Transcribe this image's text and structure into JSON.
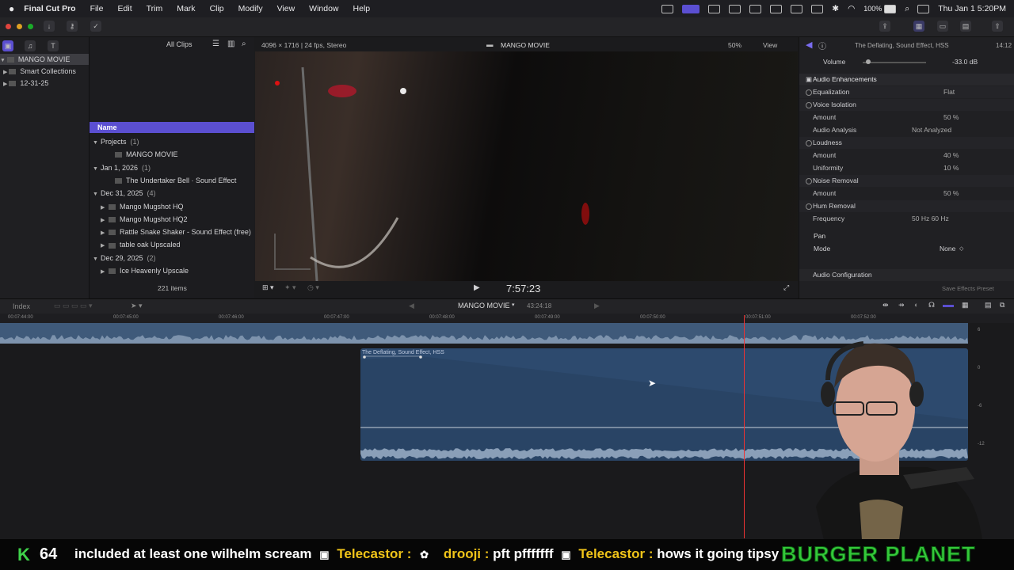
{
  "menubar": {
    "app_name": "Final Cut Pro",
    "menus": [
      "File",
      "Edit",
      "Trim",
      "Mark",
      "Clip",
      "Modify",
      "View",
      "Window",
      "Help"
    ],
    "battery": "100%",
    "clock": "Thu Jan 1  5:20PM"
  },
  "library": {
    "items": [
      {
        "label": "MANGO MOVIE",
        "selected": true
      },
      {
        "label": "Smart Collections",
        "selected": false
      },
      {
        "label": "12-31-25",
        "selected": false
      }
    ]
  },
  "browser": {
    "filter_label": "All Clips",
    "column_header": "Name",
    "rows": [
      {
        "indent": 0,
        "disclosure": "▼",
        "name": "Projects",
        "count": "(1)"
      },
      {
        "indent": 2,
        "disclosure": "",
        "name": "MANGO MOVIE",
        "count": ""
      },
      {
        "indent": 0,
        "disclosure": "▼",
        "name": "Jan 1, 2026",
        "count": "(1)"
      },
      {
        "indent": 2,
        "disclosure": "",
        "name": "The Undertaker Bell · Sound Effect",
        "count": ""
      },
      {
        "indent": 0,
        "disclosure": "▼",
        "name": "Dec 31, 2025",
        "count": "(4)"
      },
      {
        "indent": 1,
        "disclosure": "▶",
        "name": "Mango Mugshot HQ",
        "count": ""
      },
      {
        "indent": 1,
        "disclosure": "▶",
        "name": "Mango Mugshot HQ2",
        "count": ""
      },
      {
        "indent": 1,
        "disclosure": "▶",
        "name": "Rattle Snake Shaker - Sound Effect (free)",
        "count": ""
      },
      {
        "indent": 1,
        "disclosure": "▶",
        "name": "table oak Upscaled",
        "count": ""
      },
      {
        "indent": 0,
        "disclosure": "▼",
        "name": "Dec 29, 2025",
        "count": "(2)"
      },
      {
        "indent": 1,
        "disclosure": "▶",
        "name": "Ice Heavenly Upscale",
        "count": ""
      }
    ],
    "item_count": "221 items"
  },
  "viewer": {
    "format": "4096 × 1716 | 24 fps, Stereo",
    "title": "MANGO MOVIE",
    "zoom": "50%",
    "view_menu": "View",
    "timecode": "7:57:23"
  },
  "inspector": {
    "clip_title": "The Deflating, Sound Effect, HSS",
    "duration": "14:12",
    "volume_label": "Volume",
    "volume_value": "-33.0 dB",
    "section_title": "Audio Enhancements",
    "rows": [
      {
        "label": "Equalization",
        "value": "Flat",
        "check": true
      },
      {
        "label": "Voice Isolation",
        "value": "",
        "check": true
      },
      {
        "label": "Amount",
        "value": "50 %",
        "check": false
      },
      {
        "label": "Audio Analysis",
        "value": "Not Analyzed",
        "check": false
      },
      {
        "label": "Loudness",
        "value": "",
        "check": true
      },
      {
        "label": "Amount",
        "value": "40 %",
        "check": false
      },
      {
        "label": "Uniformity",
        "value": "10 %",
        "check": false
      },
      {
        "label": "Noise Removal",
        "value": "",
        "check": true
      },
      {
        "label": "Amount",
        "value": "50 %",
        "check": false
      },
      {
        "label": "Hum Removal",
        "value": "",
        "check": true
      },
      {
        "label": "Frequency",
        "value": "50 Hz    60 Hz",
        "check": false
      }
    ],
    "pan_title": "Pan",
    "mode_label": "Mode",
    "mode_value": "None",
    "audio_config": "Audio Configuration",
    "save_preset": "Save Effects Preset"
  },
  "timeline": {
    "index_label": "Index",
    "project_name": "MANGO MOVIE",
    "duration": "43:24:18",
    "ruler_ticks": [
      "00:07:44:00",
      "00:07:45:00",
      "00:07:46:00",
      "00:07:47:00",
      "00:07:48:00",
      "00:07:49:00",
      "00:07:50:00",
      "00:07:51:00",
      "00:07:52:00"
    ],
    "clip_name": "The Deflating, Sound Effect, HSS",
    "meter_labels": [
      "6",
      "0",
      "-6",
      "-12"
    ]
  },
  "overlay": {
    "counter_letter": "K",
    "counter_value": "64",
    "ticker_segments": [
      {
        "user": "",
        "text": "included at least one wilhelm scream"
      },
      {
        "user": "Telecastor :",
        "text": ""
      },
      {
        "user": "drooji :",
        "text": "pft pfffffff"
      },
      {
        "user": "Telecastor :",
        "text": "hows it going tipsy"
      }
    ],
    "brand": "BURGER PLANET"
  },
  "colors": {
    "accent_purple": "#5b4fd1",
    "clip_blue": "#2d4a6e",
    "waveform": "#7d93ad",
    "playhead": "#e33333",
    "ticker_yellow": "#f0c419",
    "ticker_green": "#3fd24a",
    "brand_green": "#34c83a"
  }
}
